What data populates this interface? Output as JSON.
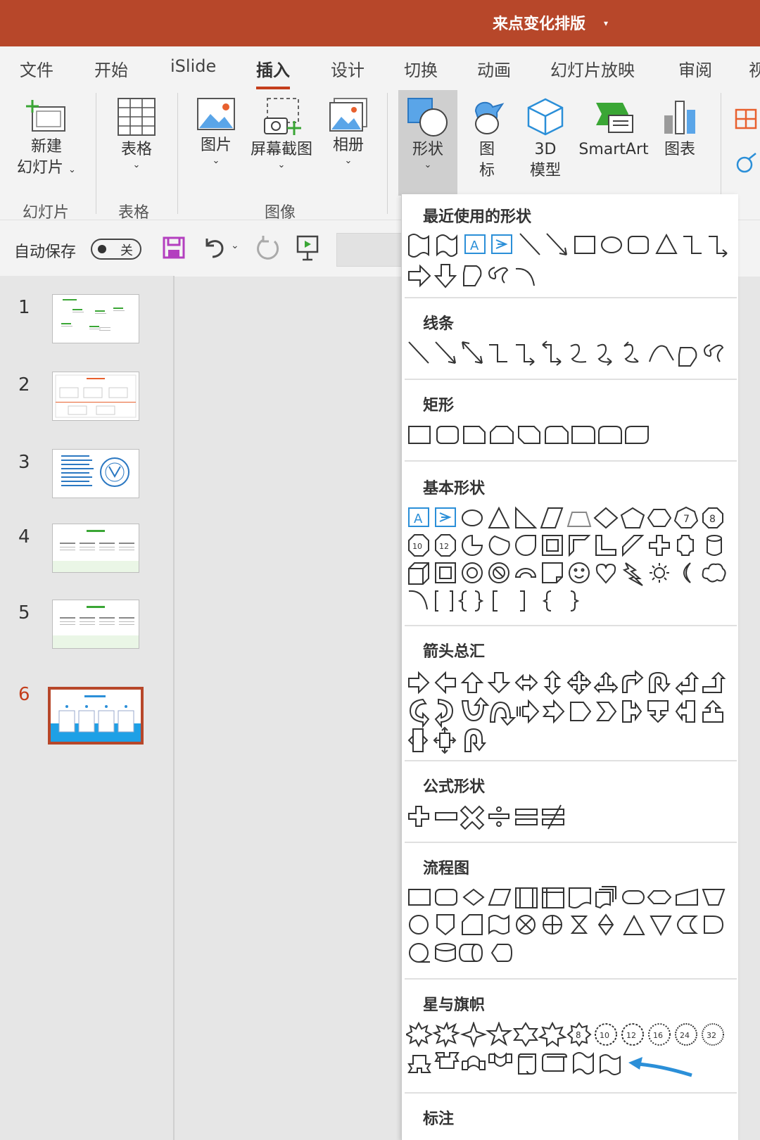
{
  "titlebar": {
    "document": "来点变化排版",
    "caret": "▾"
  },
  "tabs": [
    "文件",
    "开始",
    "iSlide",
    "插入",
    "设计",
    "切换",
    "动画",
    "幻灯片放映",
    "审阅",
    "视"
  ],
  "ribbon": {
    "new_slide": {
      "line1": "新建",
      "line2": "幻灯片"
    },
    "table": "表格",
    "picture": "图片",
    "screenshot": "屏幕截图",
    "album": "相册",
    "shapes": "形状",
    "icons": {
      "line1": "图",
      "line2": "标"
    },
    "model3d": {
      "line1": "3D",
      "line2": "模型"
    },
    "smartart": "SmartArt",
    "chart": "图表",
    "groups": {
      "slides": "幻灯片",
      "tables": "表格",
      "images": "图像"
    },
    "chevron": "⌄"
  },
  "qat": {
    "autosave": "自动保存",
    "toggle_state": "关"
  },
  "slides": [
    {
      "num": "1",
      "selected": false
    },
    {
      "num": "2",
      "selected": false
    },
    {
      "num": "3",
      "selected": false
    },
    {
      "num": "4",
      "selected": false
    },
    {
      "num": "5",
      "selected": false
    },
    {
      "num": "6",
      "selected": true
    }
  ],
  "gallery": {
    "recent": "最近使用的形状",
    "lines": "线条",
    "rectangles": "矩形",
    "basic": "基本形状",
    "arrows": "箭头总汇",
    "equation": "公式形状",
    "flowchart": "流程图",
    "stars": "星与旗帜",
    "callouts": "标注",
    "octagon_labels": [
      "7",
      "8",
      "10",
      "12"
    ],
    "star_labels": [
      "8",
      "10",
      "12",
      "16",
      "24",
      "32"
    ]
  },
  "colors": {
    "accent": "#b7472a",
    "tab_underline": "#c43e1c",
    "pointer_arrow": "#2b8fd8"
  }
}
